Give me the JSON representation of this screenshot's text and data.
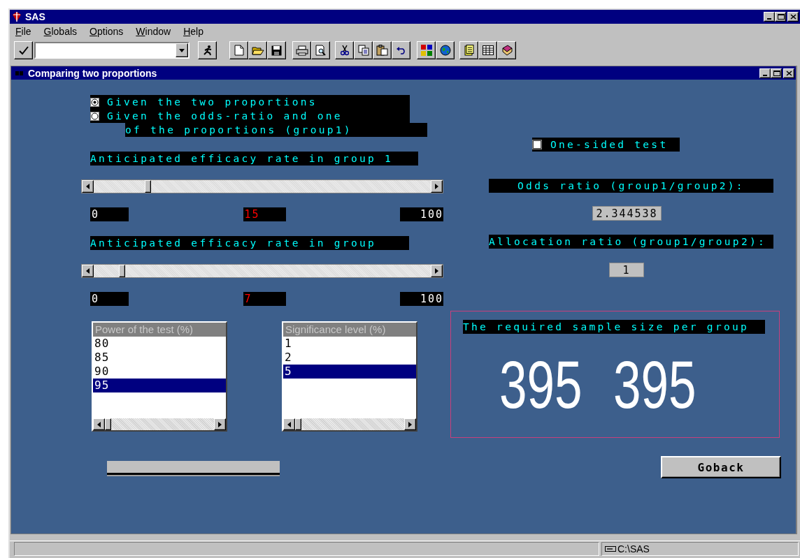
{
  "window": {
    "title": "SAS"
  },
  "menu": [
    {
      "label": "File"
    },
    {
      "label": "Globals"
    },
    {
      "label": "Options"
    },
    {
      "label": "Window"
    },
    {
      "label": "Help"
    }
  ],
  "inner_window": {
    "title": "Comparing two proportions"
  },
  "form": {
    "input_mode": [
      {
        "label": "Given the two proportions",
        "selected": true
      },
      {
        "label": "Given the odds-ratio and one",
        "label_continued": "of the proportions (group1)",
        "selected": false
      }
    ],
    "one_sided": {
      "label": "One-sided test",
      "checked": false
    },
    "sliders": [
      {
        "label": "Anticipated efficacy rate in group 1",
        "min": "0",
        "value": "15",
        "max": "100"
      },
      {
        "label": "Anticipated efficacy rate in group",
        "min": "0",
        "value": "7",
        "max": "100"
      }
    ],
    "odds_ratio": {
      "label": "Odds ratio (group1/group2):",
      "value": "2.344538"
    },
    "allocation_ratio": {
      "label": "Allocation ratio (group1/group2):",
      "value": "1"
    },
    "lists": [
      {
        "title": "Power of the test (%)",
        "items": [
          {
            "text": "80",
            "selected": false
          },
          {
            "text": "85",
            "selected": false
          },
          {
            "text": "90",
            "selected": false
          },
          {
            "text": "95",
            "selected": true
          }
        ]
      },
      {
        "title": "Significance level (%)",
        "items": [
          {
            "text": "1",
            "selected": false
          },
          {
            "text": "2",
            "selected": false
          },
          {
            "text": "5",
            "selected": true
          }
        ]
      }
    ],
    "result": {
      "label": "The required sample size per group",
      "values": [
        "395",
        "395"
      ]
    },
    "buttons": [
      "Goback"
    ]
  },
  "status_bar": {
    "path": "C:\\SAS"
  }
}
